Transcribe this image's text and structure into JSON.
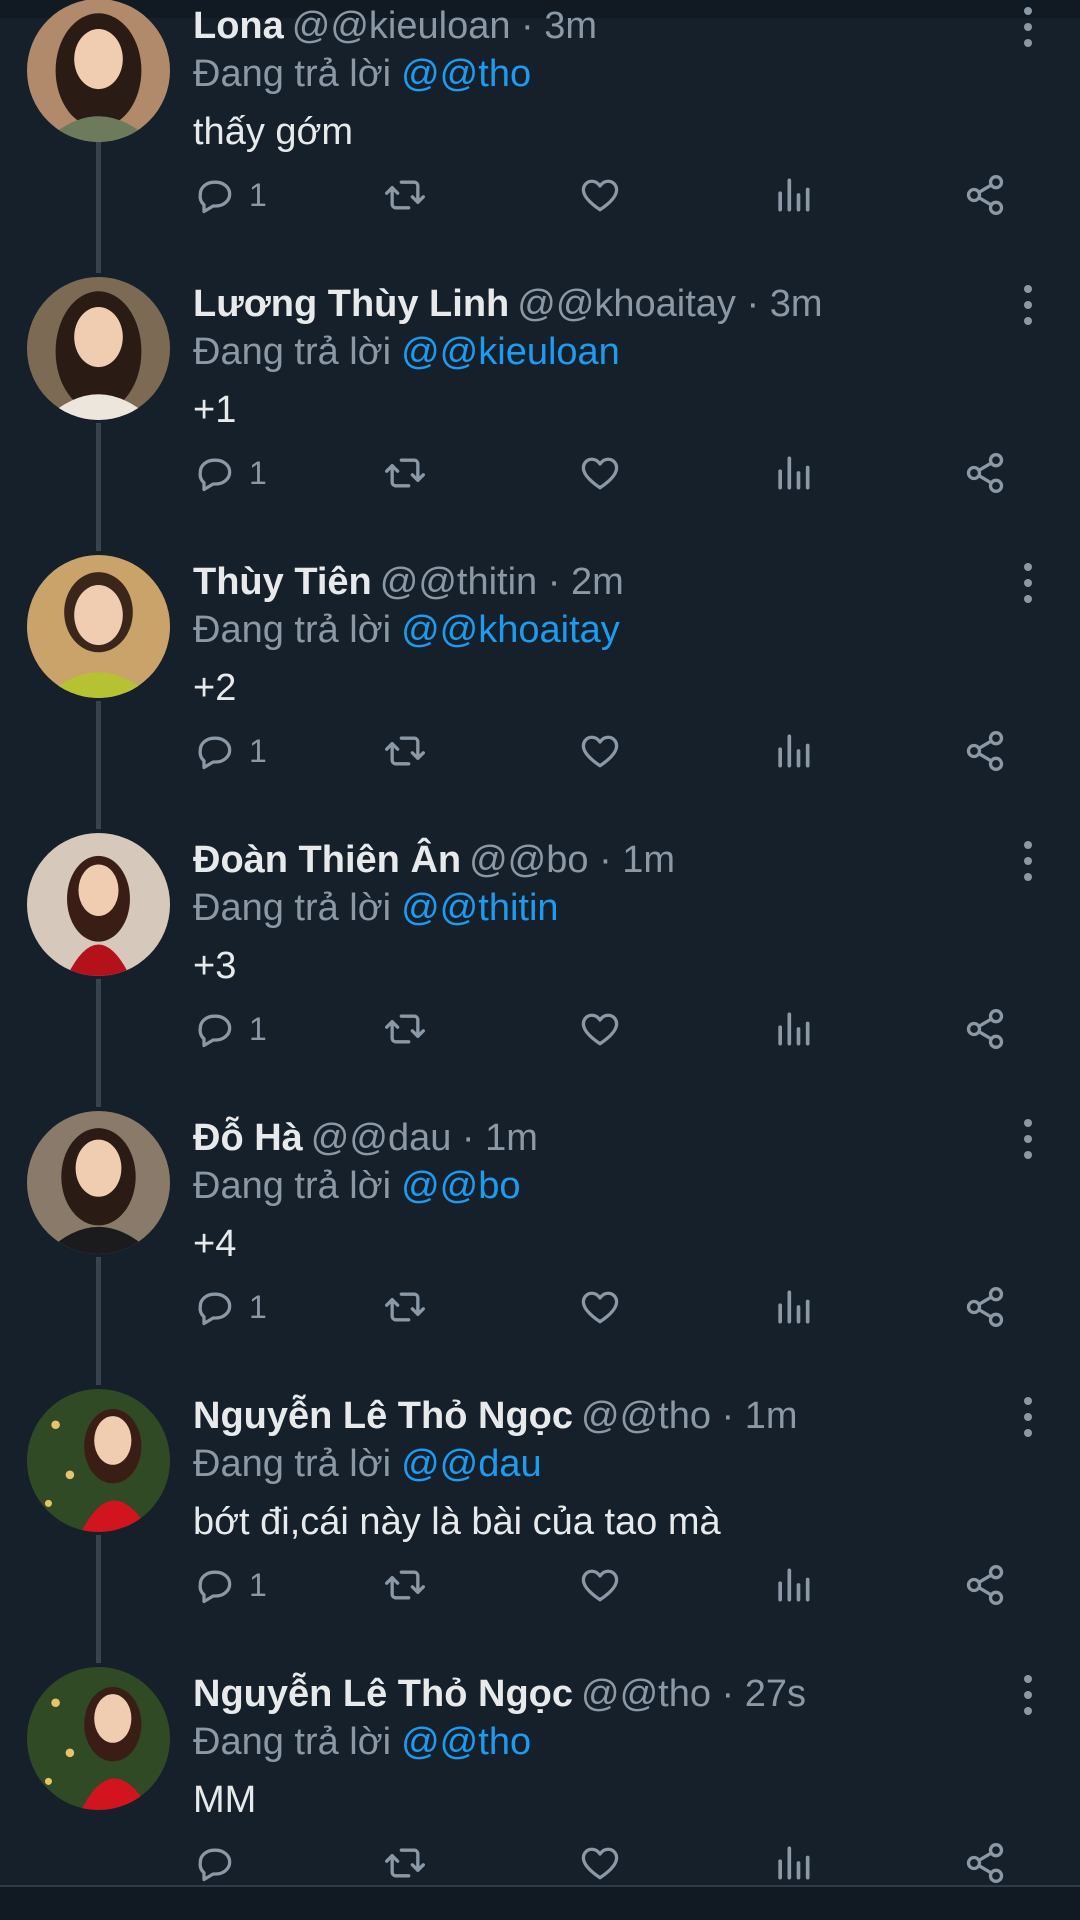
{
  "reply_prefix": "Đang trả lời",
  "tweets": [
    {
      "name": "Lona",
      "handle": "@@kieuloan · 3m",
      "reply_to": "@@tho",
      "text": "thấy gớm",
      "replies": "1",
      "avatar_bg": "#b08a6a",
      "avatar_dress": "#6e7a5c"
    },
    {
      "name": "Lương Thùy Linh",
      "handle": "@@khoaitay · 3m",
      "reply_to": "@@kieuloan",
      "text": "+1",
      "replies": "1",
      "avatar_bg": "#7c6a55",
      "avatar_dress": "#ece6dc"
    },
    {
      "name": "Thùy Tiên",
      "handle": "@@thitin · 2m",
      "reply_to": "@@khoaitay",
      "text": "+2",
      "replies": "1",
      "avatar_bg": "#c9a36a",
      "avatar_dress": "#b7c233"
    },
    {
      "name": "Đoàn Thiên Ân",
      "handle": "@@bo · 1m",
      "reply_to": "@@thitin",
      "text": "+3",
      "replies": "1",
      "avatar_bg": "#d6c8bb",
      "avatar_dress": "#b3121b"
    },
    {
      "name": "Đỗ Hà",
      "handle": "@@dau · 1m",
      "reply_to": "@@bo",
      "text": "+4",
      "replies": "1",
      "avatar_bg": "#8a7a6a",
      "avatar_dress": "#1b1b1d"
    },
    {
      "name": "Nguyễn Lê Thỏ Ngọc",
      "handle": "@@tho · 1m",
      "reply_to": "@@dau",
      "text": "bớt đi,cái này là bài của tao mà",
      "replies": "1",
      "avatar_bg": "#2f4a24",
      "avatar_dress": "#d2141f"
    },
    {
      "name": "Nguyễn Lê Thỏ Ngọc",
      "handle": "@@tho · 27s",
      "reply_to": "@@tho",
      "text": "MM",
      "replies": "",
      "avatar_bg": "#2f4a24",
      "avatar_dress": "#d2141f"
    }
  ]
}
